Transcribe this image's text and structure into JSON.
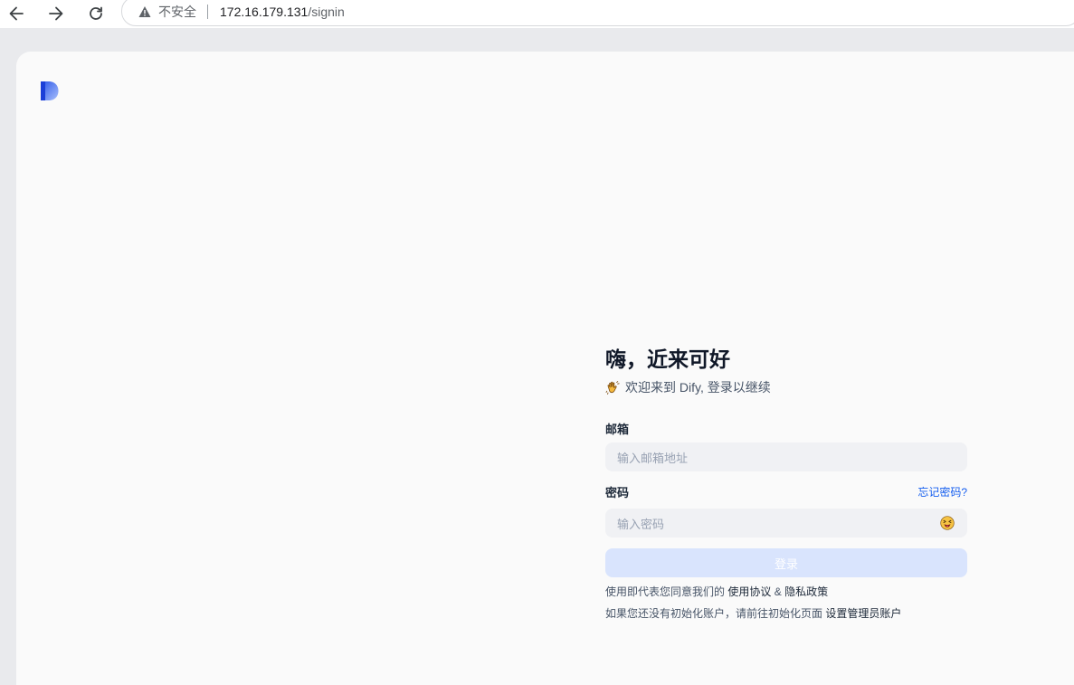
{
  "browser": {
    "insecure_label": "不安全",
    "url_host": "172.16.179.131",
    "url_path": "/signin"
  },
  "login": {
    "title": "嗨，近来可好",
    "subtitle": "欢迎来到 Dify, 登录以继续",
    "email_label": "邮箱",
    "email_placeholder": "输入邮箱地址",
    "password_label": "密码",
    "forgot_password": "忘记密码?",
    "password_placeholder": "输入密码",
    "submit_label": "登录",
    "terms_prefix": "使用即代表您同意我们的",
    "terms_link": "使用协议",
    "terms_and": "&",
    "privacy_link": "隐私政策",
    "setup_prefix": "如果您还没有初始化账户，请前往初始化页面",
    "setup_link": "设置管理员账户"
  },
  "colors": {
    "accent": "#155eef",
    "button_disabled": "#d9e4fd",
    "input_bg": "#f0f1f4"
  },
  "icons": [
    "back-arrow-icon",
    "forward-arrow-icon",
    "reload-icon",
    "warning-icon",
    "dify-logo",
    "waving-hand-icon",
    "squinting-tongue-emoji-icon"
  ]
}
